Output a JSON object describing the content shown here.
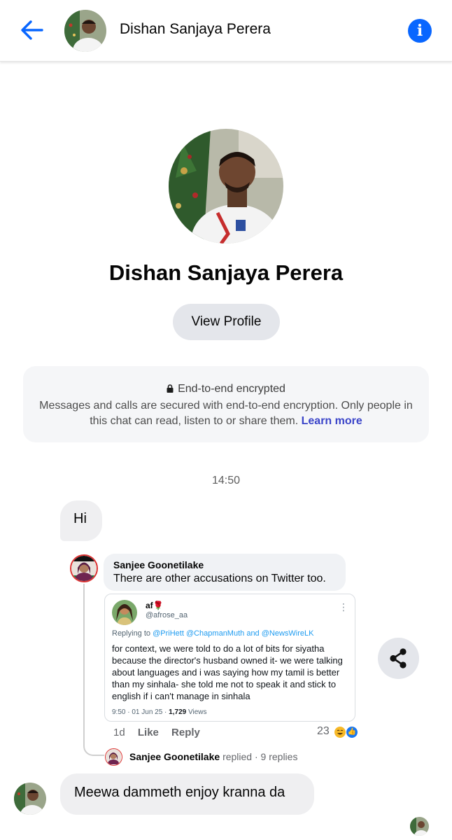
{
  "header": {
    "title": "Dishan Sanjaya Perera",
    "back_icon": "arrow-left-icon",
    "info_icon": "info-icon",
    "accent": "#0866ff"
  },
  "profile": {
    "name": "Dishan Sanjaya Perera",
    "view_profile_label": "View Profile"
  },
  "encryption": {
    "title": "End-to-end encrypted",
    "body": "Messages and calls are secured with end-to-end encryption. Only people in this chat can read, listen to or share them.",
    "link": "Learn more",
    "link_color": "#3b45c9"
  },
  "conversation": {
    "timestamp": "14:50",
    "messages": [
      {
        "text": "Hi"
      },
      {
        "text": "Meewa dammeth enjoy kranna da"
      }
    ]
  },
  "shared_post": {
    "comment_author": "Sanjee Goonetilake",
    "comment_text": "There are other accusations on Twitter too.",
    "tweet": {
      "name": "af🌹",
      "handle": "@afrose_aa",
      "replying_prefix": "Replying to",
      "replying_mentions": "@PriHett @ChapmanMuth and @NewsWireLK",
      "body": "for context, we were told to do a lot of bits for siyatha because the director's husband owned it- we were talking about languages and i was saying how my tamil is better than my sinhala- she told me not to speak it and stick to english if i can't manage in sinhala",
      "time_date": "9:50 · 01 Jun 25 ·",
      "views_count": "1,729",
      "views_label": "Views",
      "more_icon": "more-vertical-icon"
    },
    "actions": {
      "age": "1d",
      "like": "Like",
      "reply": "Reply",
      "reaction_count": "23"
    },
    "replies": {
      "author": "Sanjee Goonetilake",
      "verb": "replied",
      "summary": "· 9 replies"
    },
    "share_icon": "share-icon"
  }
}
